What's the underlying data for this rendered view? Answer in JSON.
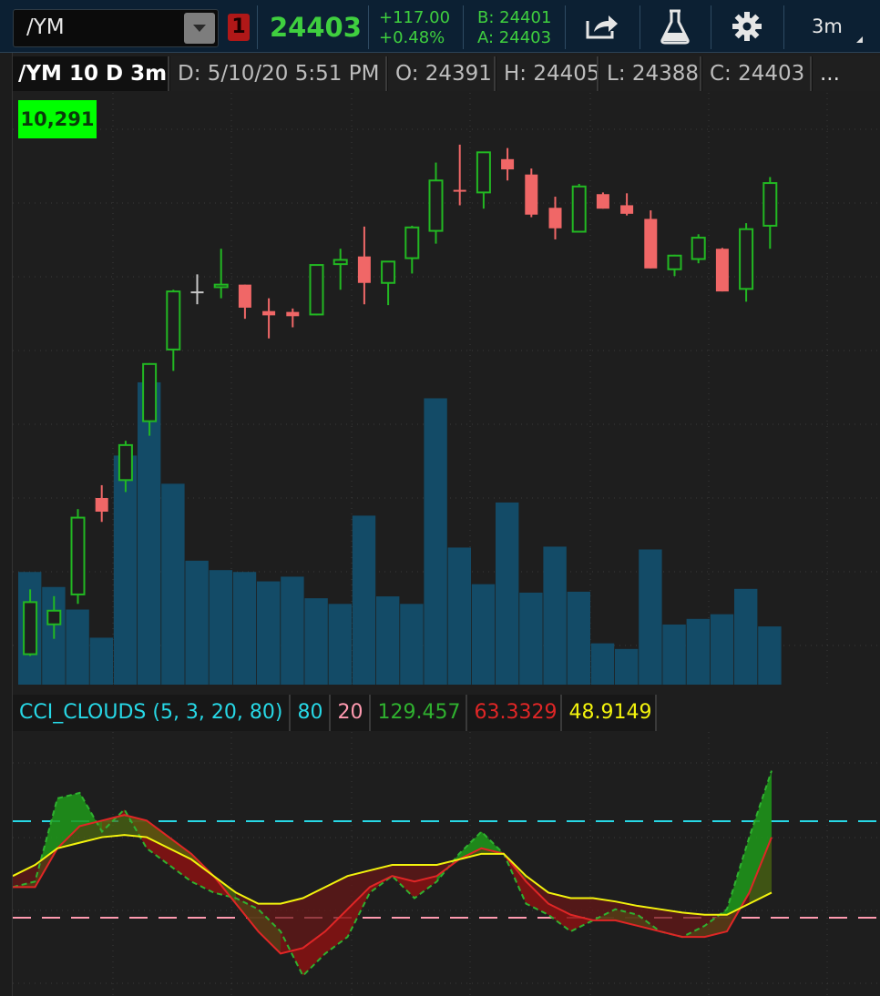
{
  "toolbar": {
    "symbol": "/YM",
    "link_number": "1",
    "last_price": "24403",
    "change_abs": "+117.00",
    "change_pct": "+0.48%",
    "bid": "B: 24401",
    "ask": "A: 24403",
    "timeframe": "3m",
    "icons": [
      "share-icon",
      "flask-icon",
      "gear-icon"
    ],
    "colors": {
      "up": "#3fcf3f",
      "bg": "#0c2033"
    }
  },
  "info_strip": {
    "title": "/YM 10 D 3m",
    "date": "D: 5/10/20 5:51 PM",
    "open": "O: 24391",
    "high": "H: 24405",
    "low": "L: 24388",
    "close": "C: 24403",
    "more": "..."
  },
  "price_badge": "10,291",
  "study": {
    "name": "CCI_CLOUDS (5, 3, 20, 80)",
    "upper": "80",
    "lower": "20",
    "v1": "129.457",
    "v2": "63.3329",
    "v3": "48.9149",
    "colors": {
      "name": "#27d8e6",
      "upper": "#27d8e6",
      "lower": "#ff9ab0",
      "v1": "#2fb12f",
      "v2": "#e02626",
      "v3": "#f3f30d"
    }
  },
  "chart_data": {
    "type": "candlestick",
    "candles": [
      {
        "o": 46,
        "h": 61,
        "l": -17,
        "c": -15,
        "vol": 120
      },
      {
        "o": 36,
        "h": 53,
        "l": 3,
        "c": 20,
        "vol": 104
      },
      {
        "o": 55,
        "h": 155,
        "l": 44,
        "c": 145,
        "vol": 80
      },
      {
        "o": 152,
        "h": 183,
        "l": 140,
        "c": 168,
        "vol": 50
      },
      {
        "o": 189,
        "h": 235,
        "l": 175,
        "c": 230,
        "vol": 244
      },
      {
        "o": 258,
        "h": 326,
        "l": 241,
        "c": 325,
        "vol": 322
      },
      {
        "o": 342,
        "h": 412,
        "l": 317,
        "c": 410,
        "vol": 214
      },
      {
        "o": 410,
        "h": 430,
        "l": 395,
        "c": 410,
        "vol": 132
      },
      {
        "o": 415,
        "h": 460,
        "l": 402,
        "c": 418,
        "vol": 122
      },
      {
        "o": 418,
        "h": 407,
        "l": 378,
        "c": 391,
        "vol": 120
      },
      {
        "o": 387,
        "h": 402,
        "l": 355,
        "c": 382,
        "vol": 110
      },
      {
        "o": 386,
        "h": 390,
        "l": 368,
        "c": 381,
        "vol": 115
      },
      {
        "o": 383,
        "h": 437,
        "l": 382,
        "c": 441,
        "vol": 92
      },
      {
        "o": 442,
        "h": 460,
        "l": 412,
        "c": 447,
        "vol": 86
      },
      {
        "o": 451,
        "h": 486,
        "l": 395,
        "c": 420,
        "vol": 180
      },
      {
        "o": 420,
        "h": 443,
        "l": 394,
        "c": 445,
        "vol": 94
      },
      {
        "o": 449,
        "h": 487,
        "l": 431,
        "c": 485,
        "vol": 86
      },
      {
        "o": 481,
        "h": 561,
        "l": 466,
        "c": 540,
        "vol": 305
      },
      {
        "o": 529,
        "h": 582,
        "l": 511,
        "c": 528,
        "vol": 146
      },
      {
        "o": 526,
        "h": 570,
        "l": 507,
        "c": 573,
        "vol": 107
      },
      {
        "o": 565,
        "h": 578,
        "l": 540,
        "c": 553,
        "vol": 194
      },
      {
        "o": 547,
        "h": 554,
        "l": 497,
        "c": 500,
        "vol": 98
      },
      {
        "o": 508,
        "h": 521,
        "l": 471,
        "c": 484,
        "vol": 147
      },
      {
        "o": 480,
        "h": 536,
        "l": 479,
        "c": 533,
        "vol": 99
      },
      {
        "o": 524,
        "h": 526,
        "l": 508,
        "c": 507,
        "vol": 44
      },
      {
        "o": 511,
        "h": 525,
        "l": 499,
        "c": 501,
        "vol": 38
      },
      {
        "o": 495,
        "h": 505,
        "l": 437,
        "c": 437,
        "vol": 144
      },
      {
        "o": 436,
        "h": 453,
        "l": 428,
        "c": 452,
        "vol": 64
      },
      {
        "o": 448,
        "h": 477,
        "l": 443,
        "c": 473,
        "vol": 70
      },
      {
        "o": 460,
        "h": 461,
        "l": 410,
        "c": 410,
        "vol": 75
      },
      {
        "o": 413,
        "h": 490,
        "l": 398,
        "c": 483,
        "vol": 102
      },
      {
        "o": 487,
        "h": 544,
        "l": 460,
        "c": 537,
        "vol": 62
      }
    ],
    "candle_colors": [
      "up",
      "up",
      "up",
      "down",
      "up",
      "up",
      "up",
      "neutral",
      "up",
      "down",
      "down",
      "down",
      "up",
      "up",
      "down",
      "up",
      "up",
      "up",
      "down",
      "up",
      "down",
      "down",
      "down",
      "up",
      "down",
      "down",
      "down",
      "up",
      "up",
      "down",
      "up",
      "up"
    ],
    "cci_fast": [
      -15,
      -10,
      65,
      70,
      35,
      55,
      20,
      5,
      -10,
      -20,
      -25,
      -35,
      -55,
      -95,
      -75,
      -60,
      -20,
      -5,
      -25,
      -10,
      15,
      35,
      15,
      -30,
      -40,
      -55,
      -45,
      -35,
      -40,
      -55,
      -60,
      -50,
      -35,
      30,
      90
    ],
    "cci_slow": [
      -15,
      -15,
      20,
      40,
      45,
      50,
      45,
      30,
      15,
      -5,
      -30,
      -55,
      -75,
      -70,
      -55,
      -35,
      -15,
      -5,
      -10,
      -5,
      10,
      20,
      15,
      -10,
      -30,
      -40,
      -45,
      -45,
      -50,
      -55,
      -60,
      -60,
      -55,
      -20,
      30
    ],
    "cci_signal": [
      -5,
      5,
      20,
      25,
      30,
      32,
      30,
      20,
      10,
      -5,
      -20,
      -30,
      -30,
      -25,
      -15,
      -5,
      0,
      5,
      5,
      5,
      10,
      15,
      15,
      -5,
      -20,
      -25,
      -25,
      -28,
      -32,
      -35,
      -38,
      -40,
      -40,
      -30,
      -20
    ],
    "levels": {
      "upper": 80,
      "lower": 20
    }
  }
}
